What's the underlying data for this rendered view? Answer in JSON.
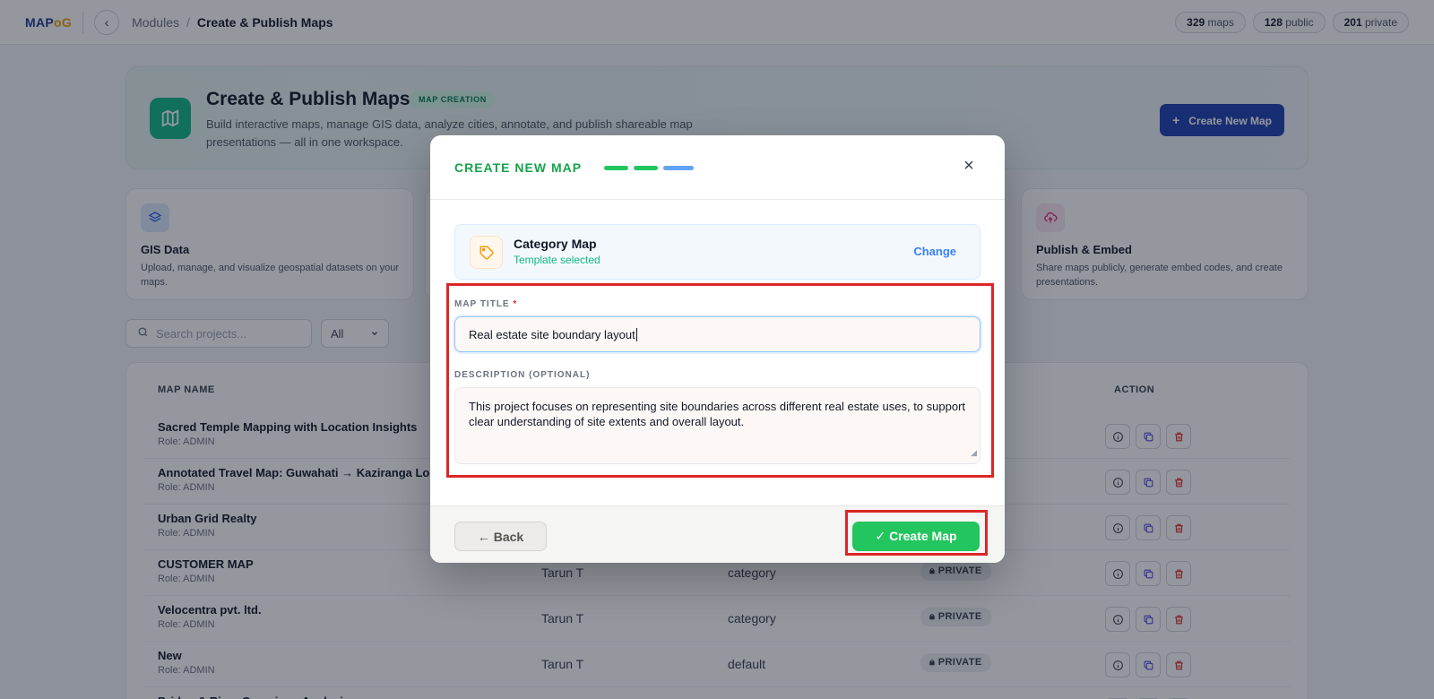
{
  "topbar": {
    "logo_main": "MAP",
    "logo_accent": "oG",
    "back_glyph": "‹",
    "breadcrumb_root": "Modules",
    "breadcrumb_sep": "/",
    "breadcrumb_current": "Create & Publish Maps",
    "stats": [
      {
        "count": "329",
        "label": "maps"
      },
      {
        "count": "128",
        "label": "public"
      },
      {
        "count": "201",
        "label": "private"
      }
    ]
  },
  "hero": {
    "title": "Create & Publish Maps",
    "badge": "MAP CREATION",
    "description": "Build interactive maps, manage GIS data, analyze cities, annotate, and publish shareable map presentations — all in one workspace.",
    "button_plus": "+",
    "button_label": "Create New Map"
  },
  "cards": [
    {
      "title": "GIS Data",
      "description": "Upload, manage, and visualize geospatial datasets on your maps.",
      "icon": "layers-icon"
    },
    {
      "title": "Publish & Embed",
      "description": "Share maps publicly, generate embed codes, and create presentations.",
      "icon": "cloud-upload-icon"
    }
  ],
  "search": {
    "placeholder": "Search projects...",
    "filter_value": "All"
  },
  "table": {
    "headers": {
      "name": "MAP NAME",
      "action": "ACTION"
    },
    "rows": [
      {
        "name": "Sacred Temple Mapping with Location Insights",
        "role": "Role: ADMIN",
        "owner": "",
        "type": "",
        "visibility": ""
      },
      {
        "name": "Annotated Travel Map: Guwahati → Kaziranga Loop",
        "role": "Role: ADMIN",
        "owner": "",
        "type": "",
        "visibility": ""
      },
      {
        "name": "Urban Grid Realty",
        "role": "Role: ADMIN",
        "owner": "",
        "type": "",
        "visibility": ""
      },
      {
        "name": "CUSTOMER MAP",
        "role": "Role: ADMIN",
        "owner": "Tarun T",
        "type": "category",
        "visibility": "PRIVATE"
      },
      {
        "name": "Velocentra pvt. ltd.",
        "role": "Role: ADMIN",
        "owner": "Tarun T",
        "type": "category",
        "visibility": "PRIVATE"
      },
      {
        "name": "New",
        "role": "Role: ADMIN",
        "owner": "Tarun T",
        "type": "default",
        "visibility": "PRIVATE"
      },
      {
        "name": "Bridge & River Crossings Analysis",
        "role": "Role: ADMIN",
        "owner": "",
        "type": "",
        "visibility": ""
      }
    ]
  },
  "modal": {
    "title": "CREATE NEW MAP",
    "close_glyph": "×",
    "template_name": "Category Map",
    "template_status": "Template selected",
    "template_change": "Change",
    "title_label": "MAP TITLE",
    "required_mark": "*",
    "title_value": "Real estate site boundary layout",
    "description_label": "DESCRIPTION (OPTIONAL)",
    "description_value": "This project focuses on representing site boundaries across different real estate uses, to support clear understanding of site extents and overall layout.",
    "back_label": "← Back",
    "create_label": "✓ Create Map"
  },
  "colors": {
    "step_done": "#22c55e",
    "step_current": "#60a5fa",
    "highlight": "#dc2626",
    "brand": "#1e40af"
  }
}
